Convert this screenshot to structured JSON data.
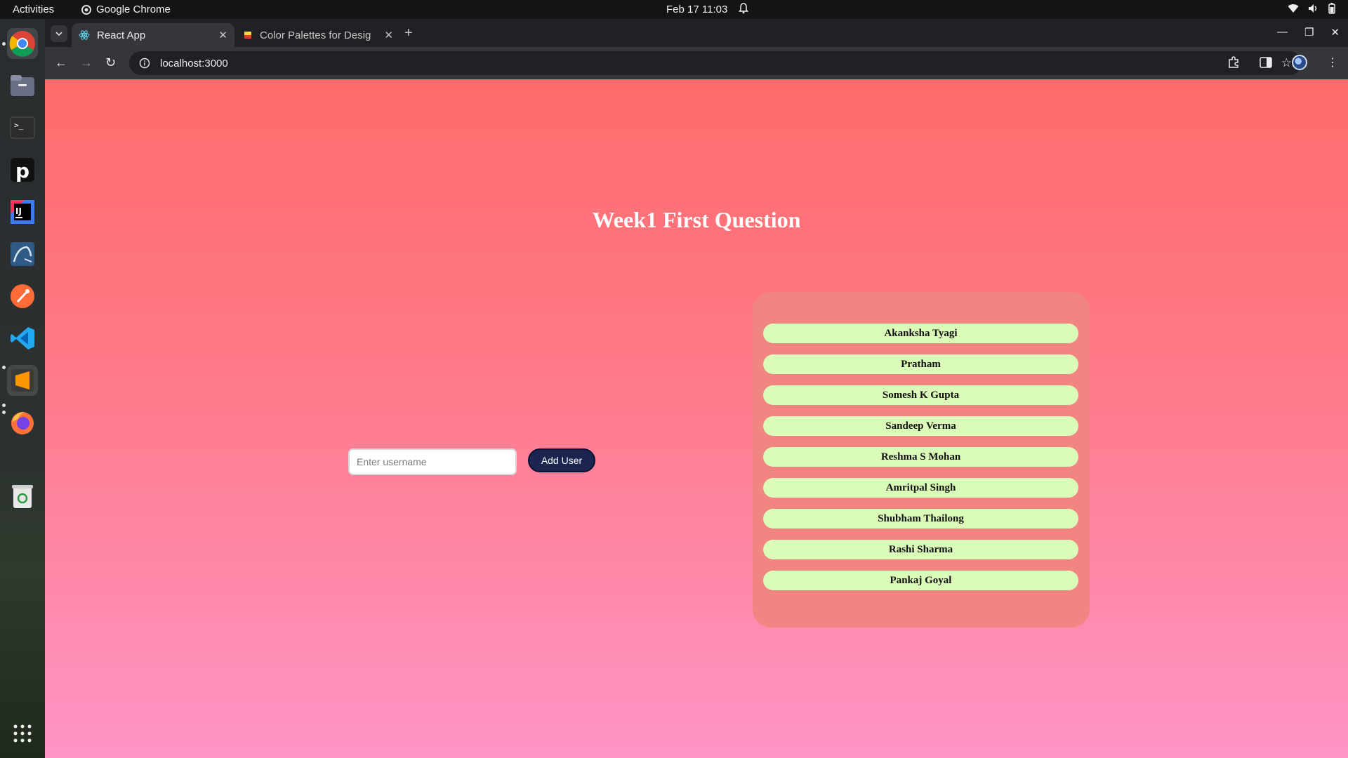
{
  "topbar": {
    "activities": "Activities",
    "app_name": "Google Chrome",
    "clock": "Feb 17  11:03"
  },
  "dock": {
    "apps": [
      "chrome-icon",
      "files-icon",
      "terminal-icon",
      "pycharm-icon",
      "intellij-icon",
      "mysql-workbench-icon",
      "postman-icon",
      "vscode-icon",
      "sublime-text-icon",
      "firefox-icon",
      "trash-icon",
      "app-grid-icon"
    ]
  },
  "browser": {
    "tabs": [
      {
        "title": "React App",
        "active": true
      },
      {
        "title": "Color Palettes for Desig",
        "active": false
      }
    ],
    "url": "localhost:3000"
  },
  "app": {
    "heading": "Week1 First Question",
    "input_placeholder": "Enter username",
    "input_value": "",
    "add_button_label": "Add User",
    "users": [
      "Akanksha Tyagi",
      "Pratham",
      "Somesh K Gupta",
      "Sandeep Verma",
      "Reshma S Mohan",
      "Amritpal Singh",
      "Shubham Thailong",
      "Rashi Sharma",
      "Pankaj Goyal"
    ]
  },
  "colors": {
    "page_gradient_top": "#ff6b6b",
    "page_gradient_bottom": "#ff95c6",
    "panel": "#f08582",
    "list_item": "#dbfbb8",
    "button": "#1b2550"
  }
}
